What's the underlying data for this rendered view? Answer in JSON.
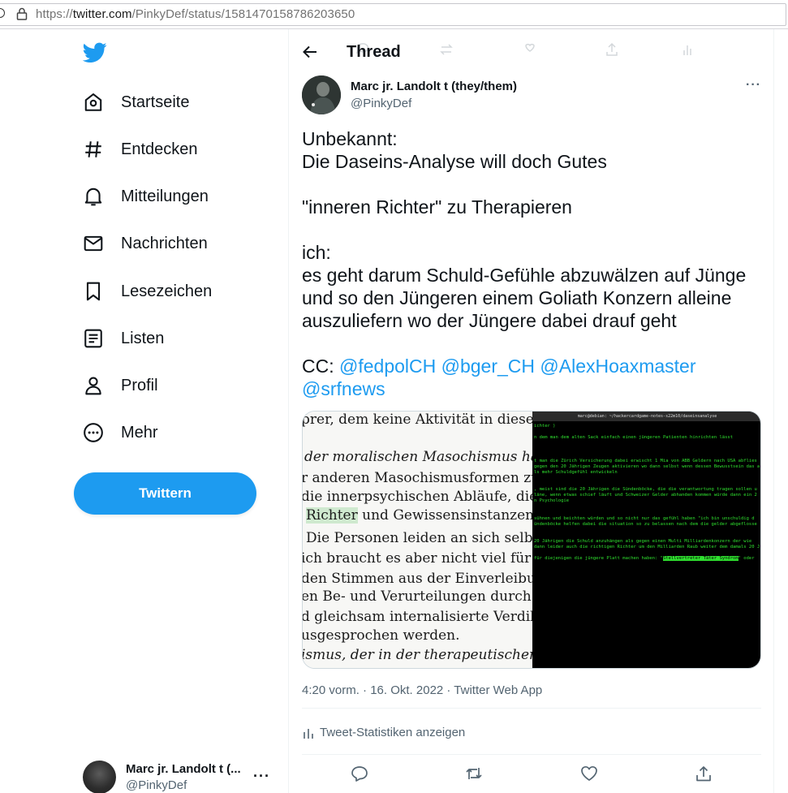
{
  "browser": {
    "url_prefix": "https://",
    "url_host": "twitter.com",
    "url_path": "/PinkyDef/status/1581470158786203650"
  },
  "sidebar": {
    "items": [
      {
        "label": "Startseite",
        "icon": "home-icon"
      },
      {
        "label": "Entdecken",
        "icon": "hashtag-icon"
      },
      {
        "label": "Mitteilungen",
        "icon": "bell-icon"
      },
      {
        "label": "Nachrichten",
        "icon": "mail-icon"
      },
      {
        "label": "Lesezeichen",
        "icon": "bookmark-icon"
      },
      {
        "label": "Listen",
        "icon": "list-icon"
      },
      {
        "label": "Profil",
        "icon": "person-icon"
      },
      {
        "label": "Mehr",
        "icon": "more-circle-icon"
      }
    ],
    "tweet_button": "Twittern",
    "account": {
      "name": "Marc jr. Landolt t (...",
      "handle": "@PinkyDef",
      "more": "···"
    }
  },
  "header": {
    "title": "Thread"
  },
  "tweet": {
    "author_name": "Marc jr. Landolt t (they/them)",
    "author_handle": "@PinkyDef",
    "more": "···",
    "text_main": "Unbekannt:\nDie Daseins-Analyse will doch Gutes\n\n\"inneren Richter\" zu Therapieren\n\nich:\nes geht darum Schuld-Gefühle abzuwälzen auf Jünge\nund so den Jüngeren einem Goliath Konzern alleine\nauszuliefern wo der Jüngere dabei drauf geht\n\nCC: ",
    "mentions": [
      "@fedpolCH",
      "@bger_CH",
      "@AlexHoaxmaster",
      "@srfnews"
    ],
    "timestamp": "4:20 vorm. · 16. Okt. 2022 · Twitter Web App",
    "stats_label": "Tweet-Statistiken anzeigen"
  },
  "media": {
    "book_lines": [
      "prer, dem keine Aktivität in diesem gr",
      "der moralischen Masochismus haben",
      "r anderen Masochismusformen zu t",
      "die innerpsychischen Abläufe, die sic",
      "Richter und Gewissensinstanzen und d",
      " Die Personen leiden an sich selbst, sie",
      "ich braucht es aber nicht viel für die Pa",
      "den Stimmen aus der Einverleibung de",
      "en Be- und Verurteilungen durch die",
      "d gleichsam internalisierte Verdikte, d",
      "usgesprochen werden.",
      "ismus, der in der therapeutischen Prax"
    ],
    "terminal_title": "marc@debian: ~/hackercardgame-notes-s22m10/daseinsanalyse",
    "terminal_lines": [
      "ichter )",
      "",
      "n dem man dem alten Sack einfach einen jüngeren Patienten hinrichten lässt",
      "",
      "",
      "",
      "t man die Zürich Versicherung dabei erwischt 1 Mia von ABB Geldern nach USA abflies",
      "gegen den 20 Jährigen Zeugen aktivieren wo dann selbst wenn dessen Bewusstsein das a",
      "ls mehr Schuldgefühl entwickeln",
      "",
      "",
      ", meist sind die 20 Jährigen die Sündenböcke, die die verantwortung tragen sollen u",
      "läne, wenn etwas schief läuft und Schweizer Gelder abhanden kommen würde dann ein 2",
      "n Psychologie",
      "",
      "",
      " sühnen und beichten würden und so nicht nur das gefühl haben \"ich bin unschuldig d",
      "ündenböcke helfen dabei die situation so zu belassen nach dem die gelder abgeflosse",
      "",
      "",
      " 20 Jährigen die Schuld anzuhängen als gegen einen Multi Milliardenkonzern der wie",
      "dann leider auch die richtigen Richter um den Milliarden Raub weiter dem damals 20 J",
      "",
      " für diejenigen die jüngere Platt machen haben: \"Stellvertreter Täter Syndrom\" oder"
    ],
    "terminal_highlight": "Stellvertreter Täter Syndrom"
  },
  "colors": {
    "brand": "#1d9bf0",
    "text": "#0f1419",
    "muted": "#536471",
    "terminal_green": "#2fe02f"
  }
}
